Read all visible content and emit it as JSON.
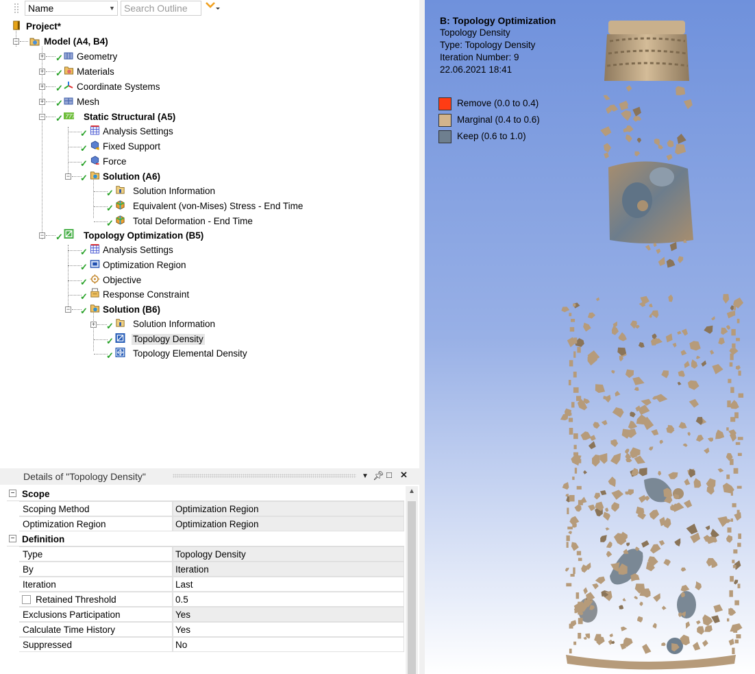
{
  "outline": {
    "column_select": "Name",
    "search_placeholder": "Search Outline",
    "tree": [
      {
        "label": "Project*",
        "bold": true,
        "icon": "project-icon"
      },
      {
        "label": "Model (A4, B4)",
        "bold": true,
        "icon": "model-icon"
      },
      {
        "label": "Geometry",
        "icon": "geometry-icon"
      },
      {
        "label": "Materials",
        "icon": "materials-icon"
      },
      {
        "label": "Coordinate Systems",
        "icon": "coordinate-systems-icon"
      },
      {
        "label": "Mesh",
        "icon": "mesh-icon"
      },
      {
        "label": "Static Structural (A5)",
        "bold": true,
        "icon": "static-structural-icon"
      },
      {
        "label": "Analysis Settings",
        "icon": "analysis-settings-icon"
      },
      {
        "label": "Fixed Support",
        "icon": "fixed-support-icon"
      },
      {
        "label": "Force",
        "icon": "force-icon"
      },
      {
        "label": "Solution (A6)",
        "bold": true,
        "icon": "solution-icon"
      },
      {
        "label": "Solution Information",
        "icon": "solution-information-icon"
      },
      {
        "label": "Equivalent (von-Mises) Stress - End Time",
        "icon": "stress-result-icon"
      },
      {
        "label": "Total Deformation - End Time",
        "icon": "deformation-result-icon"
      },
      {
        "label": "Topology Optimization (B5)",
        "bold": true,
        "icon": "topology-optimization-icon"
      },
      {
        "label": "Analysis Settings",
        "icon": "analysis-settings-icon"
      },
      {
        "label": "Optimization Region",
        "icon": "optimization-region-icon"
      },
      {
        "label": "Objective",
        "icon": "objective-icon"
      },
      {
        "label": "Response Constraint",
        "icon": "response-constraint-icon"
      },
      {
        "label": "Solution (B6)",
        "bold": true,
        "icon": "solution-icon"
      },
      {
        "label": "Solution Information",
        "icon": "solution-information-icon"
      },
      {
        "label": "Topology Density",
        "icon": "topology-density-icon",
        "selected": true
      },
      {
        "label": "Topology Elemental Density",
        "icon": "topology-elemental-density-icon"
      }
    ]
  },
  "details": {
    "title": "Details of \"Topology Density\"",
    "sections": [
      {
        "title": "Scope",
        "props": [
          {
            "key": "Scoping Method",
            "value": "Optimization Region",
            "readonly": true
          },
          {
            "key": "Optimization Region",
            "value": "Optimization Region",
            "readonly": true
          }
        ]
      },
      {
        "title": "Definition",
        "props": [
          {
            "key": "Type",
            "value": "Topology Density",
            "readonly": true
          },
          {
            "key": "By",
            "value": "Iteration",
            "readonly": true
          },
          {
            "key": "Iteration",
            "value": "Last",
            "readonly": false
          },
          {
            "key": "Retained Threshold",
            "value": "0.5",
            "readonly": false,
            "checkbox": true
          },
          {
            "key": "Exclusions Participation",
            "value": "Yes",
            "readonly": true
          },
          {
            "key": "Calculate Time History",
            "value": "Yes",
            "readonly": false
          },
          {
            "key": "Suppressed",
            "value": "No",
            "readonly": false
          }
        ]
      }
    ]
  },
  "viewport": {
    "title": "B: Topology Optimization",
    "lines": [
      "Topology Density",
      "Type: Topology Density",
      "Iteration Number: 9",
      "22.06.2021 18:41"
    ],
    "legend": [
      {
        "label": "Remove (0.0 to 0.4)",
        "color": "#ff3c14"
      },
      {
        "label": "Marginal (0.4 to 0.6)",
        "color": "#d2b48c"
      },
      {
        "label": "Keep (0.6 to 1.0)",
        "color": "#6e7f8f"
      }
    ],
    "model_color": "#b69b7a",
    "model_shade_color": "#7a8895"
  },
  "colors": {
    "check": "#25a025",
    "panel_bg": "#f0f0f0",
    "readonly_cell": "#ededed",
    "selection": "#e5e5e5"
  }
}
